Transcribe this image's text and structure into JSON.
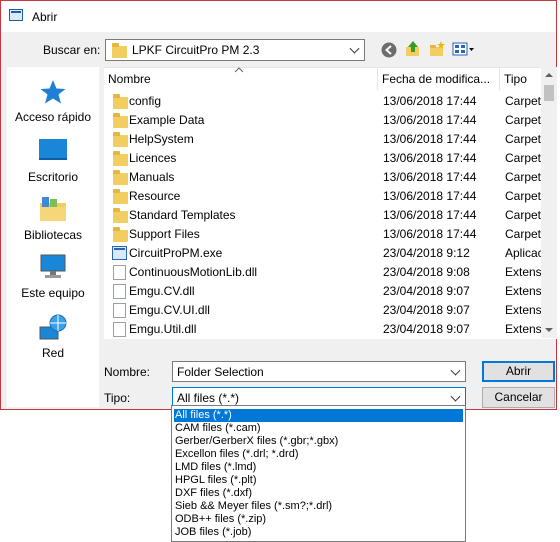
{
  "window": {
    "title": "Abrir"
  },
  "location": {
    "label": "Buscar en:",
    "value": "LPKF CircuitPro PM 2.3"
  },
  "toolbar": {
    "back_icon": "back-arrow-icon",
    "up_icon": "up-folder-icon",
    "new_folder_icon": "new-folder-icon",
    "view_icon": "view-menu-icon"
  },
  "sidebar": {
    "items": [
      {
        "label": "Acceso rápido",
        "icon": "star-icon"
      },
      {
        "label": "Escritorio",
        "icon": "desktop-icon"
      },
      {
        "label": "Bibliotecas",
        "icon": "libraries-icon"
      },
      {
        "label": "Este equipo",
        "icon": "computer-icon"
      },
      {
        "label": "Red",
        "icon": "network-icon"
      }
    ]
  },
  "columns": {
    "name": "Nombre",
    "date": "Fecha de modifica...",
    "type": "Tipo"
  },
  "files": [
    {
      "name": "config",
      "date": "13/06/2018 17:44",
      "type": "Carpeta",
      "kind": "folder"
    },
    {
      "name": "Example Data",
      "date": "13/06/2018 17:44",
      "type": "Carpeta",
      "kind": "folder"
    },
    {
      "name": "HelpSystem",
      "date": "13/06/2018 17:44",
      "type": "Carpeta",
      "kind": "folder"
    },
    {
      "name": "Licences",
      "date": "13/06/2018 17:44",
      "type": "Carpeta",
      "kind": "folder"
    },
    {
      "name": "Manuals",
      "date": "13/06/2018 17:44",
      "type": "Carpeta",
      "kind": "folder"
    },
    {
      "name": "Resource",
      "date": "13/06/2018 17:44",
      "type": "Carpeta",
      "kind": "folder"
    },
    {
      "name": "Standard Templates",
      "date": "13/06/2018 17:44",
      "type": "Carpeta",
      "kind": "folder"
    },
    {
      "name": "Support Files",
      "date": "13/06/2018 17:44",
      "type": "Carpeta",
      "kind": "folder"
    },
    {
      "name": "CircuitProPM.exe",
      "date": "23/04/2018 9:12",
      "type": "Aplicación",
      "kind": "exe"
    },
    {
      "name": "ContinuousMotionLib.dll",
      "date": "23/04/2018 9:08",
      "type": "Extensión",
      "kind": "dll"
    },
    {
      "name": "Emgu.CV.dll",
      "date": "23/04/2018 9:07",
      "type": "Extensión",
      "kind": "dll"
    },
    {
      "name": "Emgu.CV.UI.dll",
      "date": "23/04/2018 9:07",
      "type": "Extensión",
      "kind": "dll"
    },
    {
      "name": "Emgu.Util.dll",
      "date": "23/04/2018 9:07",
      "type": "Extensión",
      "kind": "dll"
    }
  ],
  "filename": {
    "label": "Nombre:",
    "value": "Folder Selection"
  },
  "filetype": {
    "label": "Tipo:",
    "value": "All files (*.*)",
    "options": [
      "All files (*.*)",
      "CAM files (*.cam)",
      "Gerber/GerberX files (*.gbr;*.gbx)",
      "Excellon files (*.drl; *.drd)",
      "LMD files (*.lmd)",
      "HPGL files (*.plt)",
      "DXF files (*.dxf)",
      "Sieb && Meyer files (*.sm?;*.drl)",
      "ODB++ files (*.zip)",
      "JOB files (*.job)"
    ]
  },
  "buttons": {
    "open": "Abrir",
    "cancel": "Cancelar"
  },
  "colors": {
    "accent": "#0078d7",
    "folder": "#f2cd5f",
    "frame": "#c5373c"
  }
}
